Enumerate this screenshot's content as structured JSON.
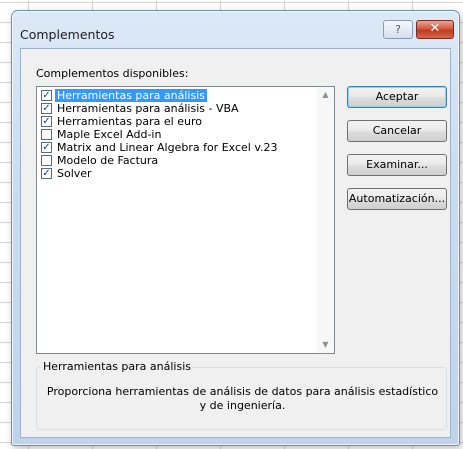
{
  "dialog": {
    "title": "Complementos",
    "help_glyph": "?",
    "close_glyph": "✕"
  },
  "addins": {
    "label": "Complementos disponibles:",
    "items": [
      {
        "label": "Herramientas para análisis",
        "checked": true,
        "selected": true
      },
      {
        "label": "Herramientas para análisis - VBA",
        "checked": true,
        "selected": false
      },
      {
        "label": "Herramientas para el euro",
        "checked": true,
        "selected": false
      },
      {
        "label": "Maple Excel Add-in",
        "checked": false,
        "selected": false
      },
      {
        "label": "Matrix and Linear Algebra for Excel  v.23",
        "checked": true,
        "selected": false
      },
      {
        "label": "Modelo de Factura",
        "checked": false,
        "selected": false
      },
      {
        "label": "Solver",
        "checked": true,
        "selected": false
      }
    ]
  },
  "buttons": {
    "ok": "Aceptar",
    "cancel": "Cancelar",
    "browse": "Examinar...",
    "automation": "Automatización..."
  },
  "description": {
    "caption": "Herramientas para análisis",
    "text": "Proporciona herramientas de análisis de datos para análisis estadístico y de ingeniería."
  },
  "icons": {
    "check": "✓",
    "scroll_up": "▲",
    "scroll_down": "▼"
  },
  "colors": {
    "selection": "#3399ff",
    "close_button": "#c03a22"
  }
}
